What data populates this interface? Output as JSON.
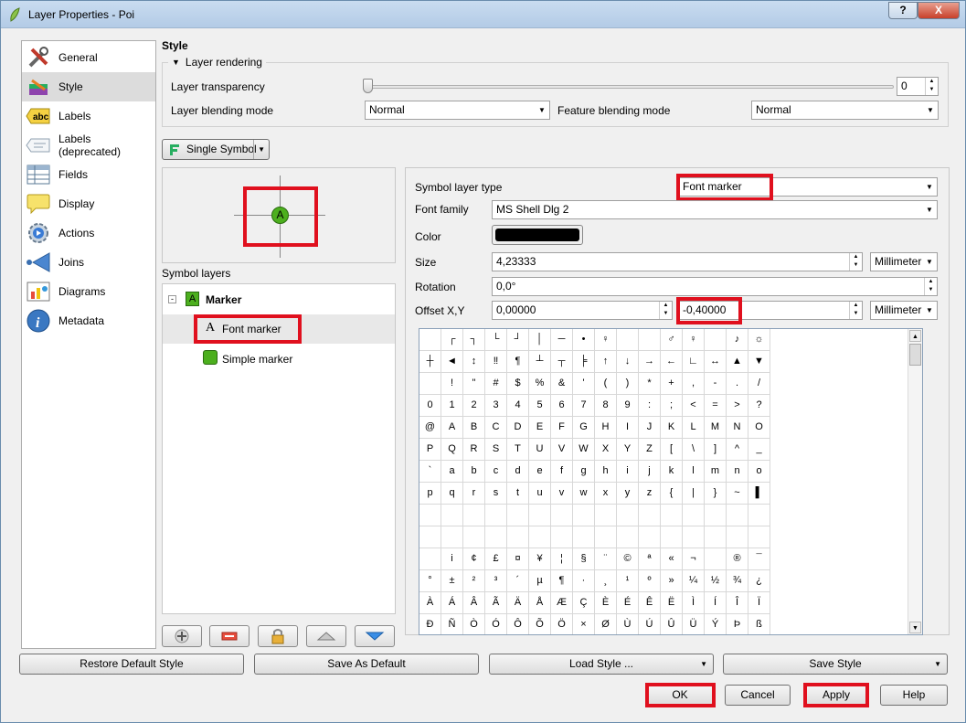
{
  "window": {
    "title": "Layer Properties - Poi",
    "help_label": "?",
    "close_label": "X"
  },
  "nav": {
    "items": [
      {
        "label": "General",
        "icon": "tools-icon"
      },
      {
        "label": "Style",
        "icon": "brush-icon"
      },
      {
        "label": "Labels",
        "icon": "abc-label-icon"
      },
      {
        "label": "Labels (deprecated)",
        "icon": "label-deprecated-icon"
      },
      {
        "label": "Fields",
        "icon": "table-icon"
      },
      {
        "label": "Display",
        "icon": "speech-bubble-icon"
      },
      {
        "label": "Actions",
        "icon": "gear-play-icon"
      },
      {
        "label": "Joins",
        "icon": "join-arrow-icon"
      },
      {
        "label": "Diagrams",
        "icon": "diagram-icon"
      },
      {
        "label": "Metadata",
        "icon": "info-icon"
      }
    ],
    "selected": "Style"
  },
  "style": {
    "section_title": "Style",
    "layer_rendering_label": "Layer rendering",
    "transparency_label": "Layer transparency",
    "transparency_value": "0",
    "blending_label": "Layer blending mode",
    "blending_value": "Normal",
    "feature_blending_label": "Feature blending mode",
    "feature_blending_value": "Normal",
    "renderer_label": "Single Symbol",
    "symbol_layers_label": "Symbol layers",
    "marker_label": "Marker",
    "marker_preview_glyph": "A",
    "font_marker_label": "Font marker",
    "font_marker_glyph": "A",
    "simple_marker_label": "Simple marker"
  },
  "props": {
    "symbol_layer_type_label": "Symbol layer type",
    "symbol_layer_type_value": "Font marker",
    "font_family_label": "Font family",
    "font_family_value": "MS Shell Dlg 2",
    "color_label": "Color",
    "color_value": "#000000",
    "size_label": "Size",
    "size_value": "4,23333",
    "size_unit": "Millimeter",
    "rotation_label": "Rotation",
    "rotation_value": "0,0°",
    "offset_label": "Offset X,Y",
    "offset_x": "0,00000",
    "offset_y": "-0,40000",
    "offset_unit": "Millimeter"
  },
  "char_grid": [
    [
      "",
      "┌",
      "┐",
      "└",
      "┘",
      "│",
      "─",
      "•",
      "♀",
      "",
      "",
      "♂",
      "♀",
      "",
      "♪",
      "☼"
    ],
    [
      "┼",
      "◄",
      "↕",
      "‼",
      "¶",
      "┴",
      "┬",
      "╞",
      "↑",
      "↓",
      "→",
      "←",
      "∟",
      "↔",
      "▲",
      "▼"
    ],
    [
      "",
      "!",
      "\"",
      "#",
      "$",
      "%",
      "&",
      "'",
      "(",
      ")",
      "*",
      "+",
      ",",
      "-",
      ".",
      "/"
    ],
    [
      "0",
      "1",
      "2",
      "3",
      "4",
      "5",
      "6",
      "7",
      "8",
      "9",
      ":",
      ";",
      "<",
      "=",
      ">",
      "?"
    ],
    [
      "@",
      "A",
      "B",
      "C",
      "D",
      "E",
      "F",
      "G",
      "H",
      "I",
      "J",
      "K",
      "L",
      "M",
      "N",
      "O"
    ],
    [
      "P",
      "Q",
      "R",
      "S",
      "T",
      "U",
      "V",
      "W",
      "X",
      "Y",
      "Z",
      "[",
      "\\",
      "]",
      "^",
      "_"
    ],
    [
      "`",
      "a",
      "b",
      "c",
      "d",
      "e",
      "f",
      "g",
      "h",
      "i",
      "j",
      "k",
      "l",
      "m",
      "n",
      "o"
    ],
    [
      "p",
      "q",
      "r",
      "s",
      "t",
      "u",
      "v",
      "w",
      "x",
      "y",
      "z",
      "{",
      "|",
      "}",
      "~",
      "▌"
    ],
    [
      "",
      "",
      "",
      "",
      "",
      "",
      "",
      "",
      "",
      "",
      "",
      "",
      "",
      "",
      "",
      ""
    ],
    [
      "",
      "",
      "",
      "",
      "",
      "",
      "",
      "",
      "",
      "",
      "",
      "",
      "",
      "",
      "",
      ""
    ],
    [
      "",
      "i",
      "¢",
      "£",
      "¤",
      "¥",
      "¦",
      "§",
      "¨",
      "©",
      "ª",
      "«",
      "¬",
      "",
      "®",
      "¯"
    ],
    [
      "°",
      "±",
      "²",
      "³",
      "´",
      "µ",
      "¶",
      "·",
      "¸",
      "¹",
      "º",
      "»",
      "¼",
      "½",
      "¾",
      "¿"
    ],
    [
      "À",
      "Á",
      "Â",
      "Ã",
      "Ä",
      "Å",
      "Æ",
      "Ç",
      "È",
      "É",
      "Ê",
      "Ë",
      "Ì",
      "Í",
      "Î",
      "Ï"
    ],
    [
      "Ð",
      "Ñ",
      "Ò",
      "Ó",
      "Ô",
      "Õ",
      "Ö",
      "×",
      "Ø",
      "Ù",
      "Ú",
      "Û",
      "Ü",
      "Ý",
      "Þ",
      "ß"
    ]
  ],
  "buttons": {
    "restore_default": "Restore Default Style",
    "save_as_default": "Save As Default",
    "load_style": "Load Style ...",
    "save_style": "Save Style",
    "ok": "OK",
    "cancel": "Cancel",
    "apply": "Apply",
    "help": "Help"
  },
  "colors": {
    "highlight_red": "#e0101e",
    "marker_green": "#4caf1e"
  }
}
